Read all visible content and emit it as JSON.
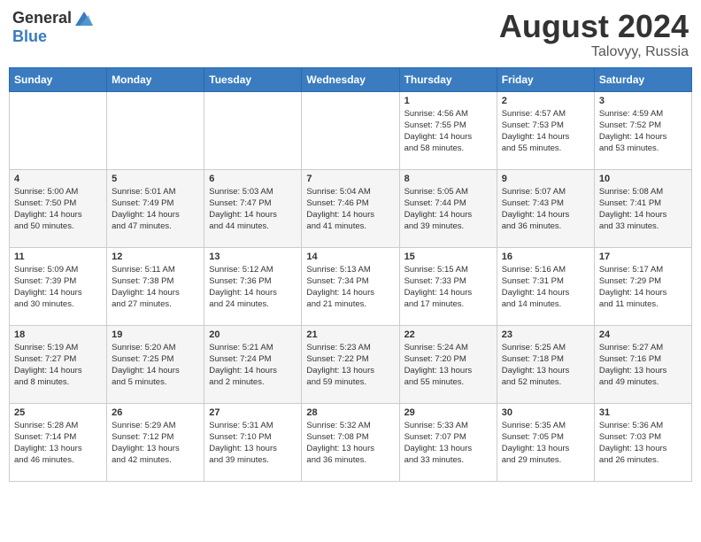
{
  "header": {
    "logo_general": "General",
    "logo_blue": "Blue",
    "month": "August 2024",
    "location": "Talovyy, Russia"
  },
  "days_of_week": [
    "Sunday",
    "Monday",
    "Tuesday",
    "Wednesday",
    "Thursday",
    "Friday",
    "Saturday"
  ],
  "weeks": [
    [
      {
        "day": "",
        "info": ""
      },
      {
        "day": "",
        "info": ""
      },
      {
        "day": "",
        "info": ""
      },
      {
        "day": "",
        "info": ""
      },
      {
        "day": "1",
        "info": "Sunrise: 4:56 AM\nSunset: 7:55 PM\nDaylight: 14 hours\nand 58 minutes."
      },
      {
        "day": "2",
        "info": "Sunrise: 4:57 AM\nSunset: 7:53 PM\nDaylight: 14 hours\nand 55 minutes."
      },
      {
        "day": "3",
        "info": "Sunrise: 4:59 AM\nSunset: 7:52 PM\nDaylight: 14 hours\nand 53 minutes."
      }
    ],
    [
      {
        "day": "4",
        "info": "Sunrise: 5:00 AM\nSunset: 7:50 PM\nDaylight: 14 hours\nand 50 minutes."
      },
      {
        "day": "5",
        "info": "Sunrise: 5:01 AM\nSunset: 7:49 PM\nDaylight: 14 hours\nand 47 minutes."
      },
      {
        "day": "6",
        "info": "Sunrise: 5:03 AM\nSunset: 7:47 PM\nDaylight: 14 hours\nand 44 minutes."
      },
      {
        "day": "7",
        "info": "Sunrise: 5:04 AM\nSunset: 7:46 PM\nDaylight: 14 hours\nand 41 minutes."
      },
      {
        "day": "8",
        "info": "Sunrise: 5:05 AM\nSunset: 7:44 PM\nDaylight: 14 hours\nand 39 minutes."
      },
      {
        "day": "9",
        "info": "Sunrise: 5:07 AM\nSunset: 7:43 PM\nDaylight: 14 hours\nand 36 minutes."
      },
      {
        "day": "10",
        "info": "Sunrise: 5:08 AM\nSunset: 7:41 PM\nDaylight: 14 hours\nand 33 minutes."
      }
    ],
    [
      {
        "day": "11",
        "info": "Sunrise: 5:09 AM\nSunset: 7:39 PM\nDaylight: 14 hours\nand 30 minutes."
      },
      {
        "day": "12",
        "info": "Sunrise: 5:11 AM\nSunset: 7:38 PM\nDaylight: 14 hours\nand 27 minutes."
      },
      {
        "day": "13",
        "info": "Sunrise: 5:12 AM\nSunset: 7:36 PM\nDaylight: 14 hours\nand 24 minutes."
      },
      {
        "day": "14",
        "info": "Sunrise: 5:13 AM\nSunset: 7:34 PM\nDaylight: 14 hours\nand 21 minutes."
      },
      {
        "day": "15",
        "info": "Sunrise: 5:15 AM\nSunset: 7:33 PM\nDaylight: 14 hours\nand 17 minutes."
      },
      {
        "day": "16",
        "info": "Sunrise: 5:16 AM\nSunset: 7:31 PM\nDaylight: 14 hours\nand 14 minutes."
      },
      {
        "day": "17",
        "info": "Sunrise: 5:17 AM\nSunset: 7:29 PM\nDaylight: 14 hours\nand 11 minutes."
      }
    ],
    [
      {
        "day": "18",
        "info": "Sunrise: 5:19 AM\nSunset: 7:27 PM\nDaylight: 14 hours\nand 8 minutes."
      },
      {
        "day": "19",
        "info": "Sunrise: 5:20 AM\nSunset: 7:25 PM\nDaylight: 14 hours\nand 5 minutes."
      },
      {
        "day": "20",
        "info": "Sunrise: 5:21 AM\nSunset: 7:24 PM\nDaylight: 14 hours\nand 2 minutes."
      },
      {
        "day": "21",
        "info": "Sunrise: 5:23 AM\nSunset: 7:22 PM\nDaylight: 13 hours\nand 59 minutes."
      },
      {
        "day": "22",
        "info": "Sunrise: 5:24 AM\nSunset: 7:20 PM\nDaylight: 13 hours\nand 55 minutes."
      },
      {
        "day": "23",
        "info": "Sunrise: 5:25 AM\nSunset: 7:18 PM\nDaylight: 13 hours\nand 52 minutes."
      },
      {
        "day": "24",
        "info": "Sunrise: 5:27 AM\nSunset: 7:16 PM\nDaylight: 13 hours\nand 49 minutes."
      }
    ],
    [
      {
        "day": "25",
        "info": "Sunrise: 5:28 AM\nSunset: 7:14 PM\nDaylight: 13 hours\nand 46 minutes."
      },
      {
        "day": "26",
        "info": "Sunrise: 5:29 AM\nSunset: 7:12 PM\nDaylight: 13 hours\nand 42 minutes."
      },
      {
        "day": "27",
        "info": "Sunrise: 5:31 AM\nSunset: 7:10 PM\nDaylight: 13 hours\nand 39 minutes."
      },
      {
        "day": "28",
        "info": "Sunrise: 5:32 AM\nSunset: 7:08 PM\nDaylight: 13 hours\nand 36 minutes."
      },
      {
        "day": "29",
        "info": "Sunrise: 5:33 AM\nSunset: 7:07 PM\nDaylight: 13 hours\nand 33 minutes."
      },
      {
        "day": "30",
        "info": "Sunrise: 5:35 AM\nSunset: 7:05 PM\nDaylight: 13 hours\nand 29 minutes."
      },
      {
        "day": "31",
        "info": "Sunrise: 5:36 AM\nSunset: 7:03 PM\nDaylight: 13 hours\nand 26 minutes."
      }
    ]
  ]
}
